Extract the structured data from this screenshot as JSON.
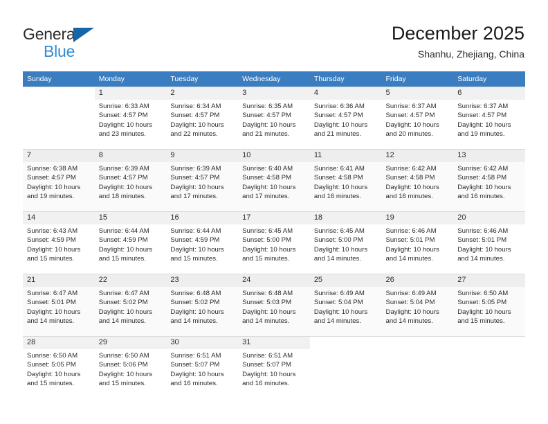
{
  "brand": {
    "name_part1": "General",
    "name_part2": "Blue",
    "triangle_color": "#1565a8",
    "blue_color": "#2e8bd8"
  },
  "header": {
    "title": "December 2025",
    "subtitle": "Shanhu, Zhejiang, China"
  },
  "theme": {
    "header_row_bg": "#3a7ec1",
    "header_row_text": "#ffffff",
    "daynum_bg": "#f1f1f1",
    "grid_line": "#d8d8d8",
    "alt_row_bg": "#fafafa"
  },
  "weekday_headers": [
    "Sunday",
    "Monday",
    "Tuesday",
    "Wednesday",
    "Thursday",
    "Friday",
    "Saturday"
  ],
  "labels": {
    "sunrise_prefix": "Sunrise:",
    "sunset_prefix": "Sunset:",
    "daylight_prefix": "Daylight:"
  },
  "weeks": [
    [
      {
        "day": "",
        "sunrise": "",
        "sunset": "",
        "daylight_line1": "",
        "daylight_line2": "",
        "empty": true
      },
      {
        "day": "1",
        "sunrise": "Sunrise: 6:33 AM",
        "sunset": "Sunset: 4:57 PM",
        "daylight_line1": "Daylight: 10 hours",
        "daylight_line2": "and 23 minutes."
      },
      {
        "day": "2",
        "sunrise": "Sunrise: 6:34 AM",
        "sunset": "Sunset: 4:57 PM",
        "daylight_line1": "Daylight: 10 hours",
        "daylight_line2": "and 22 minutes."
      },
      {
        "day": "3",
        "sunrise": "Sunrise: 6:35 AM",
        "sunset": "Sunset: 4:57 PM",
        "daylight_line1": "Daylight: 10 hours",
        "daylight_line2": "and 21 minutes."
      },
      {
        "day": "4",
        "sunrise": "Sunrise: 6:36 AM",
        "sunset": "Sunset: 4:57 PM",
        "daylight_line1": "Daylight: 10 hours",
        "daylight_line2": "and 21 minutes."
      },
      {
        "day": "5",
        "sunrise": "Sunrise: 6:37 AM",
        "sunset": "Sunset: 4:57 PM",
        "daylight_line1": "Daylight: 10 hours",
        "daylight_line2": "and 20 minutes."
      },
      {
        "day": "6",
        "sunrise": "Sunrise: 6:37 AM",
        "sunset": "Sunset: 4:57 PM",
        "daylight_line1": "Daylight: 10 hours",
        "daylight_line2": "and 19 minutes."
      }
    ],
    [
      {
        "day": "7",
        "sunrise": "Sunrise: 6:38 AM",
        "sunset": "Sunset: 4:57 PM",
        "daylight_line1": "Daylight: 10 hours",
        "daylight_line2": "and 19 minutes."
      },
      {
        "day": "8",
        "sunrise": "Sunrise: 6:39 AM",
        "sunset": "Sunset: 4:57 PM",
        "daylight_line1": "Daylight: 10 hours",
        "daylight_line2": "and 18 minutes."
      },
      {
        "day": "9",
        "sunrise": "Sunrise: 6:39 AM",
        "sunset": "Sunset: 4:57 PM",
        "daylight_line1": "Daylight: 10 hours",
        "daylight_line2": "and 17 minutes."
      },
      {
        "day": "10",
        "sunrise": "Sunrise: 6:40 AM",
        "sunset": "Sunset: 4:58 PM",
        "daylight_line1": "Daylight: 10 hours",
        "daylight_line2": "and 17 minutes."
      },
      {
        "day": "11",
        "sunrise": "Sunrise: 6:41 AM",
        "sunset": "Sunset: 4:58 PM",
        "daylight_line1": "Daylight: 10 hours",
        "daylight_line2": "and 16 minutes."
      },
      {
        "day": "12",
        "sunrise": "Sunrise: 6:42 AM",
        "sunset": "Sunset: 4:58 PM",
        "daylight_line1": "Daylight: 10 hours",
        "daylight_line2": "and 16 minutes."
      },
      {
        "day": "13",
        "sunrise": "Sunrise: 6:42 AM",
        "sunset": "Sunset: 4:58 PM",
        "daylight_line1": "Daylight: 10 hours",
        "daylight_line2": "and 16 minutes."
      }
    ],
    [
      {
        "day": "14",
        "sunrise": "Sunrise: 6:43 AM",
        "sunset": "Sunset: 4:59 PM",
        "daylight_line1": "Daylight: 10 hours",
        "daylight_line2": "and 15 minutes."
      },
      {
        "day": "15",
        "sunrise": "Sunrise: 6:44 AM",
        "sunset": "Sunset: 4:59 PM",
        "daylight_line1": "Daylight: 10 hours",
        "daylight_line2": "and 15 minutes."
      },
      {
        "day": "16",
        "sunrise": "Sunrise: 6:44 AM",
        "sunset": "Sunset: 4:59 PM",
        "daylight_line1": "Daylight: 10 hours",
        "daylight_line2": "and 15 minutes."
      },
      {
        "day": "17",
        "sunrise": "Sunrise: 6:45 AM",
        "sunset": "Sunset: 5:00 PM",
        "daylight_line1": "Daylight: 10 hours",
        "daylight_line2": "and 15 minutes."
      },
      {
        "day": "18",
        "sunrise": "Sunrise: 6:45 AM",
        "sunset": "Sunset: 5:00 PM",
        "daylight_line1": "Daylight: 10 hours",
        "daylight_line2": "and 14 minutes."
      },
      {
        "day": "19",
        "sunrise": "Sunrise: 6:46 AM",
        "sunset": "Sunset: 5:01 PM",
        "daylight_line1": "Daylight: 10 hours",
        "daylight_line2": "and 14 minutes."
      },
      {
        "day": "20",
        "sunrise": "Sunrise: 6:46 AM",
        "sunset": "Sunset: 5:01 PM",
        "daylight_line1": "Daylight: 10 hours",
        "daylight_line2": "and 14 minutes."
      }
    ],
    [
      {
        "day": "21",
        "sunrise": "Sunrise: 6:47 AM",
        "sunset": "Sunset: 5:01 PM",
        "daylight_line1": "Daylight: 10 hours",
        "daylight_line2": "and 14 minutes."
      },
      {
        "day": "22",
        "sunrise": "Sunrise: 6:47 AM",
        "sunset": "Sunset: 5:02 PM",
        "daylight_line1": "Daylight: 10 hours",
        "daylight_line2": "and 14 minutes."
      },
      {
        "day": "23",
        "sunrise": "Sunrise: 6:48 AM",
        "sunset": "Sunset: 5:02 PM",
        "daylight_line1": "Daylight: 10 hours",
        "daylight_line2": "and 14 minutes."
      },
      {
        "day": "24",
        "sunrise": "Sunrise: 6:48 AM",
        "sunset": "Sunset: 5:03 PM",
        "daylight_line1": "Daylight: 10 hours",
        "daylight_line2": "and 14 minutes."
      },
      {
        "day": "25",
        "sunrise": "Sunrise: 6:49 AM",
        "sunset": "Sunset: 5:04 PM",
        "daylight_line1": "Daylight: 10 hours",
        "daylight_line2": "and 14 minutes."
      },
      {
        "day": "26",
        "sunrise": "Sunrise: 6:49 AM",
        "sunset": "Sunset: 5:04 PM",
        "daylight_line1": "Daylight: 10 hours",
        "daylight_line2": "and 14 minutes."
      },
      {
        "day": "27",
        "sunrise": "Sunrise: 6:50 AM",
        "sunset": "Sunset: 5:05 PM",
        "daylight_line1": "Daylight: 10 hours",
        "daylight_line2": "and 15 minutes."
      }
    ],
    [
      {
        "day": "28",
        "sunrise": "Sunrise: 6:50 AM",
        "sunset": "Sunset: 5:05 PM",
        "daylight_line1": "Daylight: 10 hours",
        "daylight_line2": "and 15 minutes."
      },
      {
        "day": "29",
        "sunrise": "Sunrise: 6:50 AM",
        "sunset": "Sunset: 5:06 PM",
        "daylight_line1": "Daylight: 10 hours",
        "daylight_line2": "and 15 minutes."
      },
      {
        "day": "30",
        "sunrise": "Sunrise: 6:51 AM",
        "sunset": "Sunset: 5:07 PM",
        "daylight_line1": "Daylight: 10 hours",
        "daylight_line2": "and 16 minutes."
      },
      {
        "day": "31",
        "sunrise": "Sunrise: 6:51 AM",
        "sunset": "Sunset: 5:07 PM",
        "daylight_line1": "Daylight: 10 hours",
        "daylight_line2": "and 16 minutes."
      },
      {
        "day": "",
        "sunrise": "",
        "sunset": "",
        "daylight_line1": "",
        "daylight_line2": "",
        "empty": true
      },
      {
        "day": "",
        "sunrise": "",
        "sunset": "",
        "daylight_line1": "",
        "daylight_line2": "",
        "empty": true
      },
      {
        "day": "",
        "sunrise": "",
        "sunset": "",
        "daylight_line1": "",
        "daylight_line2": "",
        "empty": true
      }
    ]
  ]
}
